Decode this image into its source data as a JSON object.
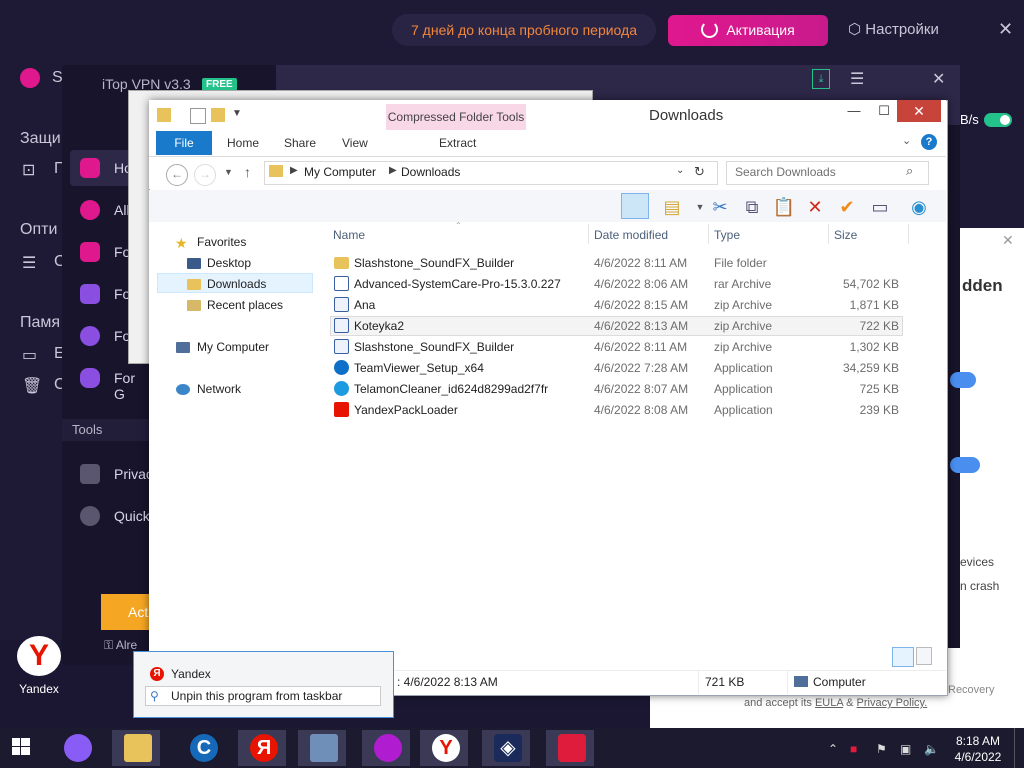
{
  "background_app": {
    "trial_text": "7 дней до конца пробного периода",
    "activate_label": "Активация",
    "settings_label": "Настройки",
    "left_labels": [
      "S",
      "Защи",
      "Г",
      "Опти",
      "С",
      "Памя",
      "Е",
      "С"
    ]
  },
  "itop": {
    "title": "iTop VPN v3.3",
    "free_badge": "FREE",
    "nav_items": [
      "Ho",
      "All",
      "Fo",
      "Fo",
      "Fo",
      "For G"
    ],
    "tools_heading": "Tools",
    "tools_items": [
      "Privac",
      "Quick"
    ],
    "activate_button": "Act",
    "already_link": "Alre",
    "speed": "B/s"
  },
  "ad": {
    "heading_fragment": "dden",
    "fragment_devices": "evices",
    "fragment_crash": "n crash",
    "recovery": "Recovery",
    "accept_prefix": "and accept its",
    "eula": "EULA",
    "amp": "&",
    "privacy": "Privacy Policy."
  },
  "desktop": {
    "yandex_icon_label": "Yandex"
  },
  "explorer": {
    "title": "Downloads",
    "contextual_tab": "Compressed Folder Tools",
    "tabs": [
      "File",
      "Home",
      "Share",
      "View",
      "Extract"
    ],
    "breadcrumb": [
      "My Computer",
      "Downloads"
    ],
    "search_placeholder": "Search Downloads",
    "nav_pane": {
      "favorites": "Favorites",
      "favorites_items": [
        "Desktop",
        "Downloads",
        "Recent places"
      ],
      "my_computer": "My Computer",
      "network": "Network"
    },
    "columns": [
      "Name",
      "Date modified",
      "Type",
      "Size"
    ],
    "files": [
      {
        "name": "Slashstone_SoundFX_Builder",
        "date": "4/6/2022 8:11 AM",
        "type": "File folder",
        "size": "",
        "icon": "folder-icon"
      },
      {
        "name": "Advanced-SystemCare-Pro-15.3.0.227",
        "date": "4/6/2022 8:06 AM",
        "type": "rar Archive",
        "size": "54,702 KB",
        "icon": "rar-icon"
      },
      {
        "name": "Ana",
        "date": "4/6/2022 8:15 AM",
        "type": "zip Archive",
        "size": "1,871 KB",
        "icon": "zip-icon"
      },
      {
        "name": "Koteyka2",
        "date": "4/6/2022 8:13 AM",
        "type": "zip Archive",
        "size": "722 KB",
        "icon": "zip-icon"
      },
      {
        "name": "Slashstone_SoundFX_Builder",
        "date": "4/6/2022 8:11 AM",
        "type": "zip Archive",
        "size": "1,302 KB",
        "icon": "zip-icon"
      },
      {
        "name": "TeamViewer_Setup_x64",
        "date": "4/6/2022 7:28 AM",
        "type": "Application",
        "size": "34,259 KB",
        "icon": "teamviewer-icon"
      },
      {
        "name": "TelamonCleaner_id624d8299ad2f7fr",
        "date": "4/6/2022 8:07 AM",
        "type": "Application",
        "size": "725 KB",
        "icon": "telamon-icon"
      },
      {
        "name": "YandexPackLoader",
        "date": "4/6/2022 8:08 AM",
        "type": "Application",
        "size": "239 KB",
        "icon": "yandex-icon"
      }
    ],
    "status": {
      "date_modified": ": 4/6/2022 8:13 AM",
      "size": "721 KB",
      "location": "Computer"
    }
  },
  "jump_list": {
    "app_name": "Yandex",
    "unpin": "Unpin this program from taskbar"
  },
  "taskbar": {
    "time": "8:18 AM",
    "date": "4/6/2022"
  },
  "colors": {
    "accent_blue": "#1979ca",
    "activate_pink": "#e0188e",
    "trial_orange": "#f2873b",
    "toggle_green": "#22c28a",
    "close_red": "#c7443a"
  }
}
